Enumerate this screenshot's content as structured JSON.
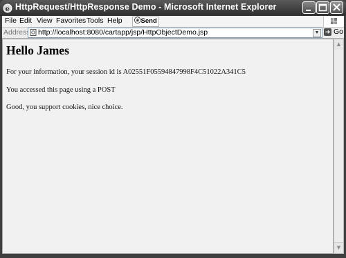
{
  "window": {
    "title": "HttpRequest/HttpResponse Demo - Microsoft Internet Explorer",
    "minimize_glyph": "_",
    "maximize_glyph": "□",
    "close_glyph": "✕"
  },
  "menubar": {
    "items": [
      "File",
      "Edit",
      "View",
      "Favorites",
      "Tools",
      "Help"
    ],
    "send_label": "Send"
  },
  "addressbar": {
    "label": "Address",
    "url": "http://localhost:8080/cartapp/jsp/HttpObjectDemo.jsp",
    "go_label": "Go"
  },
  "page": {
    "heading": "Hello James",
    "session_line": "For your information, your session id is A02551F05594847998F4C51022A341C5",
    "method_line": "You accessed this page using a POST",
    "cookie_line": "Good, you support cookies, nice choice."
  },
  "icons": {
    "app": "ie-logo-icon",
    "page": "page-icon",
    "send": "messenger-icon",
    "go": "go-arrow-icon",
    "throbber": "windows-logo-icon"
  }
}
